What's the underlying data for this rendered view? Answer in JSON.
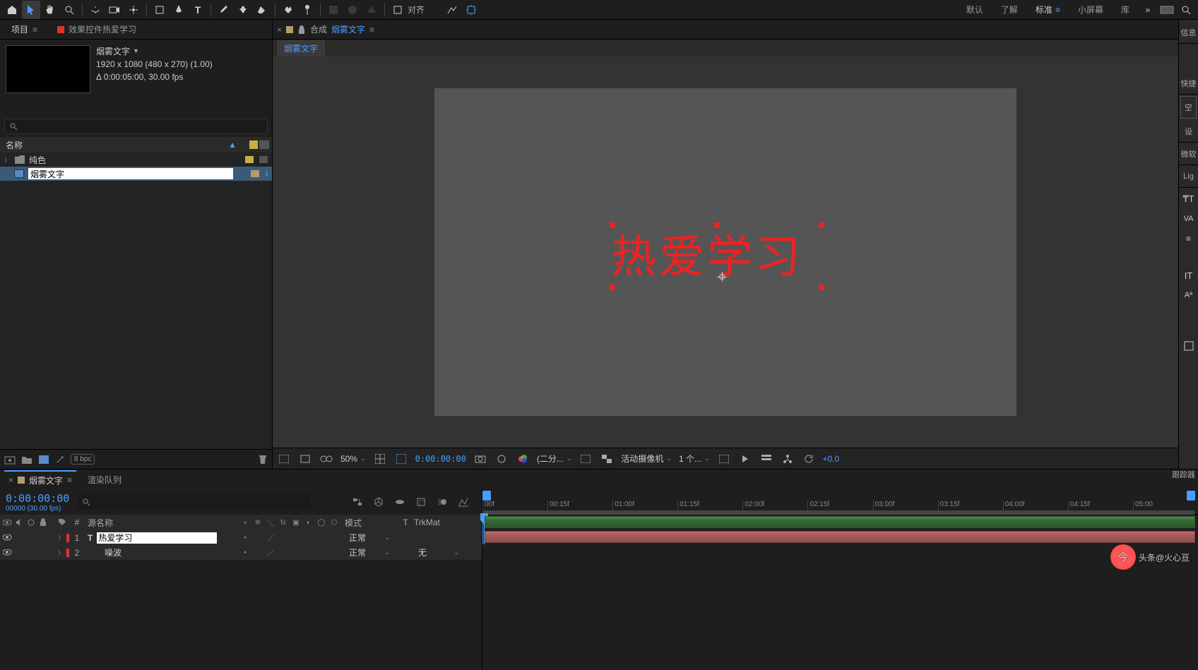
{
  "toolbar": {
    "align_label": "对齐"
  },
  "workspaces": {
    "default": "默认",
    "learn": "了解",
    "standard": "标准",
    "small": "小屏幕",
    "library": "库"
  },
  "project": {
    "title": "项目",
    "effects_tab": "效果控件热爱学习",
    "comp_name": "烟雾文字",
    "dims": "1920 x 1080  (480 x 270) (1.00)",
    "dur": "Δ 0:00:05:00, 30.00 fps",
    "name_col": "名称",
    "items": {
      "folder": "纯色",
      "comp": "烟雾文字"
    },
    "bpc": "8 bpc"
  },
  "comp_panel": {
    "label": "合成",
    "name": "烟雾文字",
    "breadcrumb": "烟雾文字",
    "text": "热爱学习"
  },
  "view_footer": {
    "zoom": "50%",
    "timecode": "0:00:00:00",
    "res": "(二分...",
    "camera": "活动摄像机",
    "views": "1 个...",
    "offset": "+0.0"
  },
  "right": {
    "info": "信息",
    "quick": "快捷",
    "space": "空",
    "design": "设",
    "micro": "微软",
    "lig": "Lig"
  },
  "timeline": {
    "tab1": "烟雾文字",
    "tab2": "渲染队列",
    "time": "0:00:00:00",
    "fps": "00000 (30.00 fps)",
    "cols": {
      "src": "源名称",
      "mode": "模式",
      "t": "T",
      "trk": "TrkMat"
    },
    "layers": {
      "l1": {
        "num": "1",
        "name": "热爱学习",
        "mode": "正常"
      },
      "l2": {
        "num": "2",
        "name": "噪波",
        "mode": "正常",
        "trk": "无"
      }
    },
    "ticks": [
      "00f",
      "00:15f",
      "01:00f",
      "01:15f",
      "02:00f",
      "02:15f",
      "03:00f",
      "03:15f",
      "04:00f",
      "04:15f",
      "05:00"
    ],
    "tracker": "跟踪器"
  },
  "watermark": "头条@火心亘"
}
